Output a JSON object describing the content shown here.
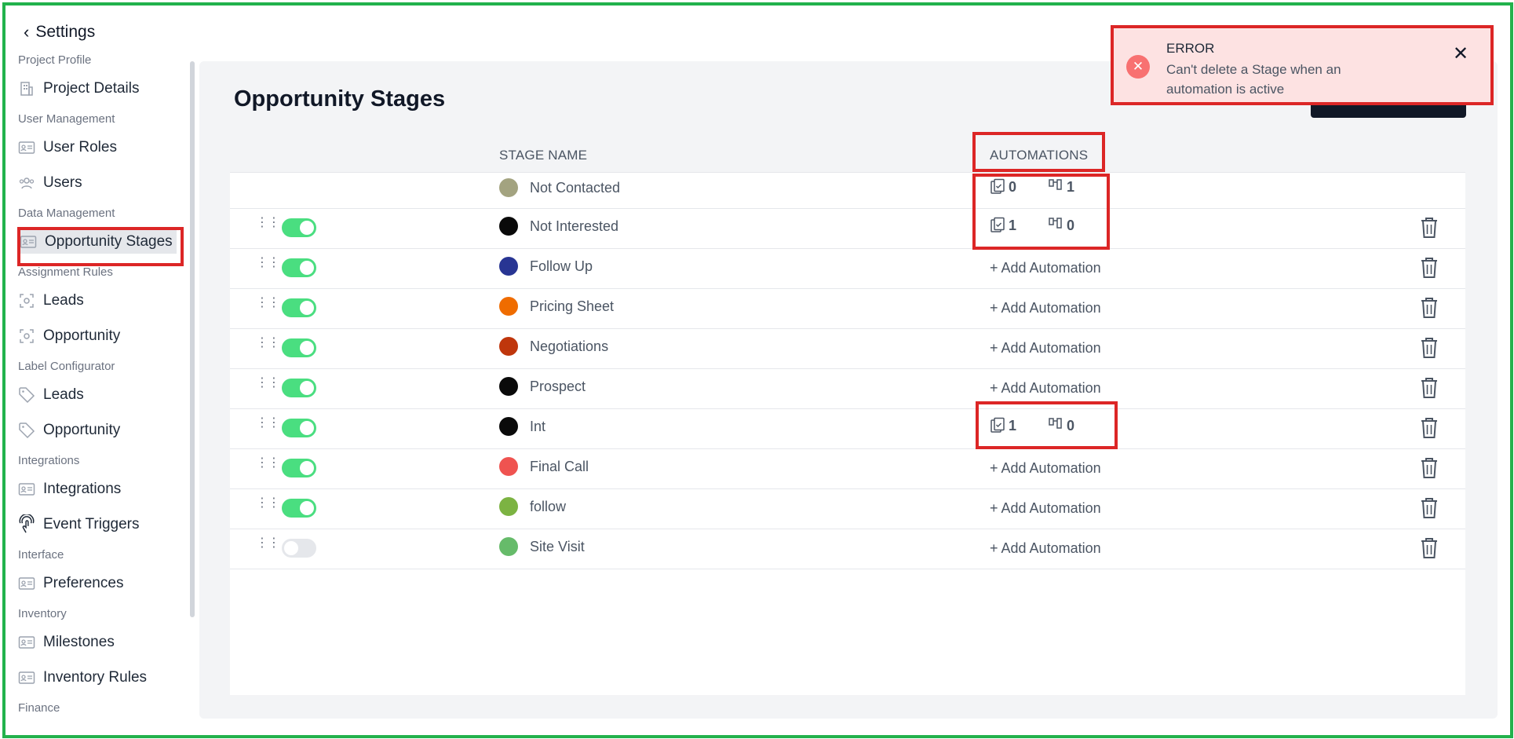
{
  "sidebar": {
    "back_label": "Settings",
    "sections": [
      {
        "label": "Project Profile",
        "items": [
          {
            "label": "Project Details",
            "icon": "building-icon"
          }
        ]
      },
      {
        "label": "User Management",
        "items": [
          {
            "label": "User Roles",
            "icon": "id-card-icon"
          },
          {
            "label": "Users",
            "icon": "users-icon"
          }
        ]
      },
      {
        "label": "Data Management",
        "items": [
          {
            "label": "Opportunity Stages",
            "icon": "id-card-icon",
            "active": true
          }
        ]
      },
      {
        "label": "Assignment Rules",
        "items": [
          {
            "label": "Leads",
            "icon": "target-icon"
          },
          {
            "label": "Opportunity",
            "icon": "target-icon"
          }
        ]
      },
      {
        "label": "Label Configurator",
        "items": [
          {
            "label": "Leads",
            "icon": "tag-icon"
          },
          {
            "label": "Opportunity",
            "icon": "tag-icon"
          }
        ]
      },
      {
        "label": "Integrations",
        "items": [
          {
            "label": "Integrations",
            "icon": "id-card-icon"
          },
          {
            "label": "Event Triggers",
            "icon": "touch-icon"
          }
        ]
      },
      {
        "label": "Interface",
        "items": [
          {
            "label": "Preferences",
            "icon": "id-card-icon"
          }
        ]
      },
      {
        "label": "Inventory",
        "items": [
          {
            "label": "Milestones",
            "icon": "id-card-icon"
          },
          {
            "label": "Inventory Rules",
            "icon": "id-card-icon"
          }
        ]
      },
      {
        "label": "Finance",
        "items": []
      }
    ]
  },
  "page": {
    "title": "Opportunity Stages"
  },
  "table": {
    "headers": {
      "stage_name": "STAGE NAME",
      "automations": "AUTOMATIONS"
    },
    "add_automation_label": "+ Add Automation",
    "rows": [
      {
        "name": "Not Contacted",
        "color": "#a3a380",
        "draggable": false,
        "toggle": null,
        "deletable": false,
        "automations": {
          "tasks": "0",
          "workflows": "1"
        }
      },
      {
        "name": "Not Interested",
        "color": "#0a0a0a",
        "draggable": true,
        "toggle": true,
        "deletable": true,
        "automations": {
          "tasks": "1",
          "workflows": "0"
        }
      },
      {
        "name": "Follow Up",
        "color": "#283593",
        "draggable": true,
        "toggle": true,
        "deletable": true,
        "automations": null
      },
      {
        "name": "Pricing Sheet",
        "color": "#ef6c00",
        "draggable": true,
        "toggle": true,
        "deletable": true,
        "automations": null
      },
      {
        "name": "Negotiations",
        "color": "#bf360c",
        "draggable": true,
        "toggle": true,
        "deletable": true,
        "automations": null
      },
      {
        "name": "Prospect",
        "color": "#0a0a0a",
        "draggable": true,
        "toggle": true,
        "deletable": true,
        "automations": null
      },
      {
        "name": "Int",
        "color": "#0a0a0a",
        "draggable": true,
        "toggle": true,
        "deletable": true,
        "automations": {
          "tasks": "1",
          "workflows": "0"
        }
      },
      {
        "name": "Final Call",
        "color": "#ef5350",
        "draggable": true,
        "toggle": true,
        "deletable": true,
        "automations": null
      },
      {
        "name": "follow",
        "color": "#7cb342",
        "draggable": true,
        "toggle": true,
        "deletable": true,
        "automations": null
      },
      {
        "name": "Site Visit",
        "color": "#66bb6a",
        "draggable": true,
        "toggle": false,
        "deletable": true,
        "automations": null
      }
    ]
  },
  "toast": {
    "title": "ERROR",
    "message": "Can't delete a Stage when an automation is active",
    "icon": "error-icon",
    "close_icon": "close-icon"
  },
  "colors": {
    "accent_toggle": "#4ade80",
    "error": "#dc2626",
    "toast_bg": "#fde2e2"
  }
}
